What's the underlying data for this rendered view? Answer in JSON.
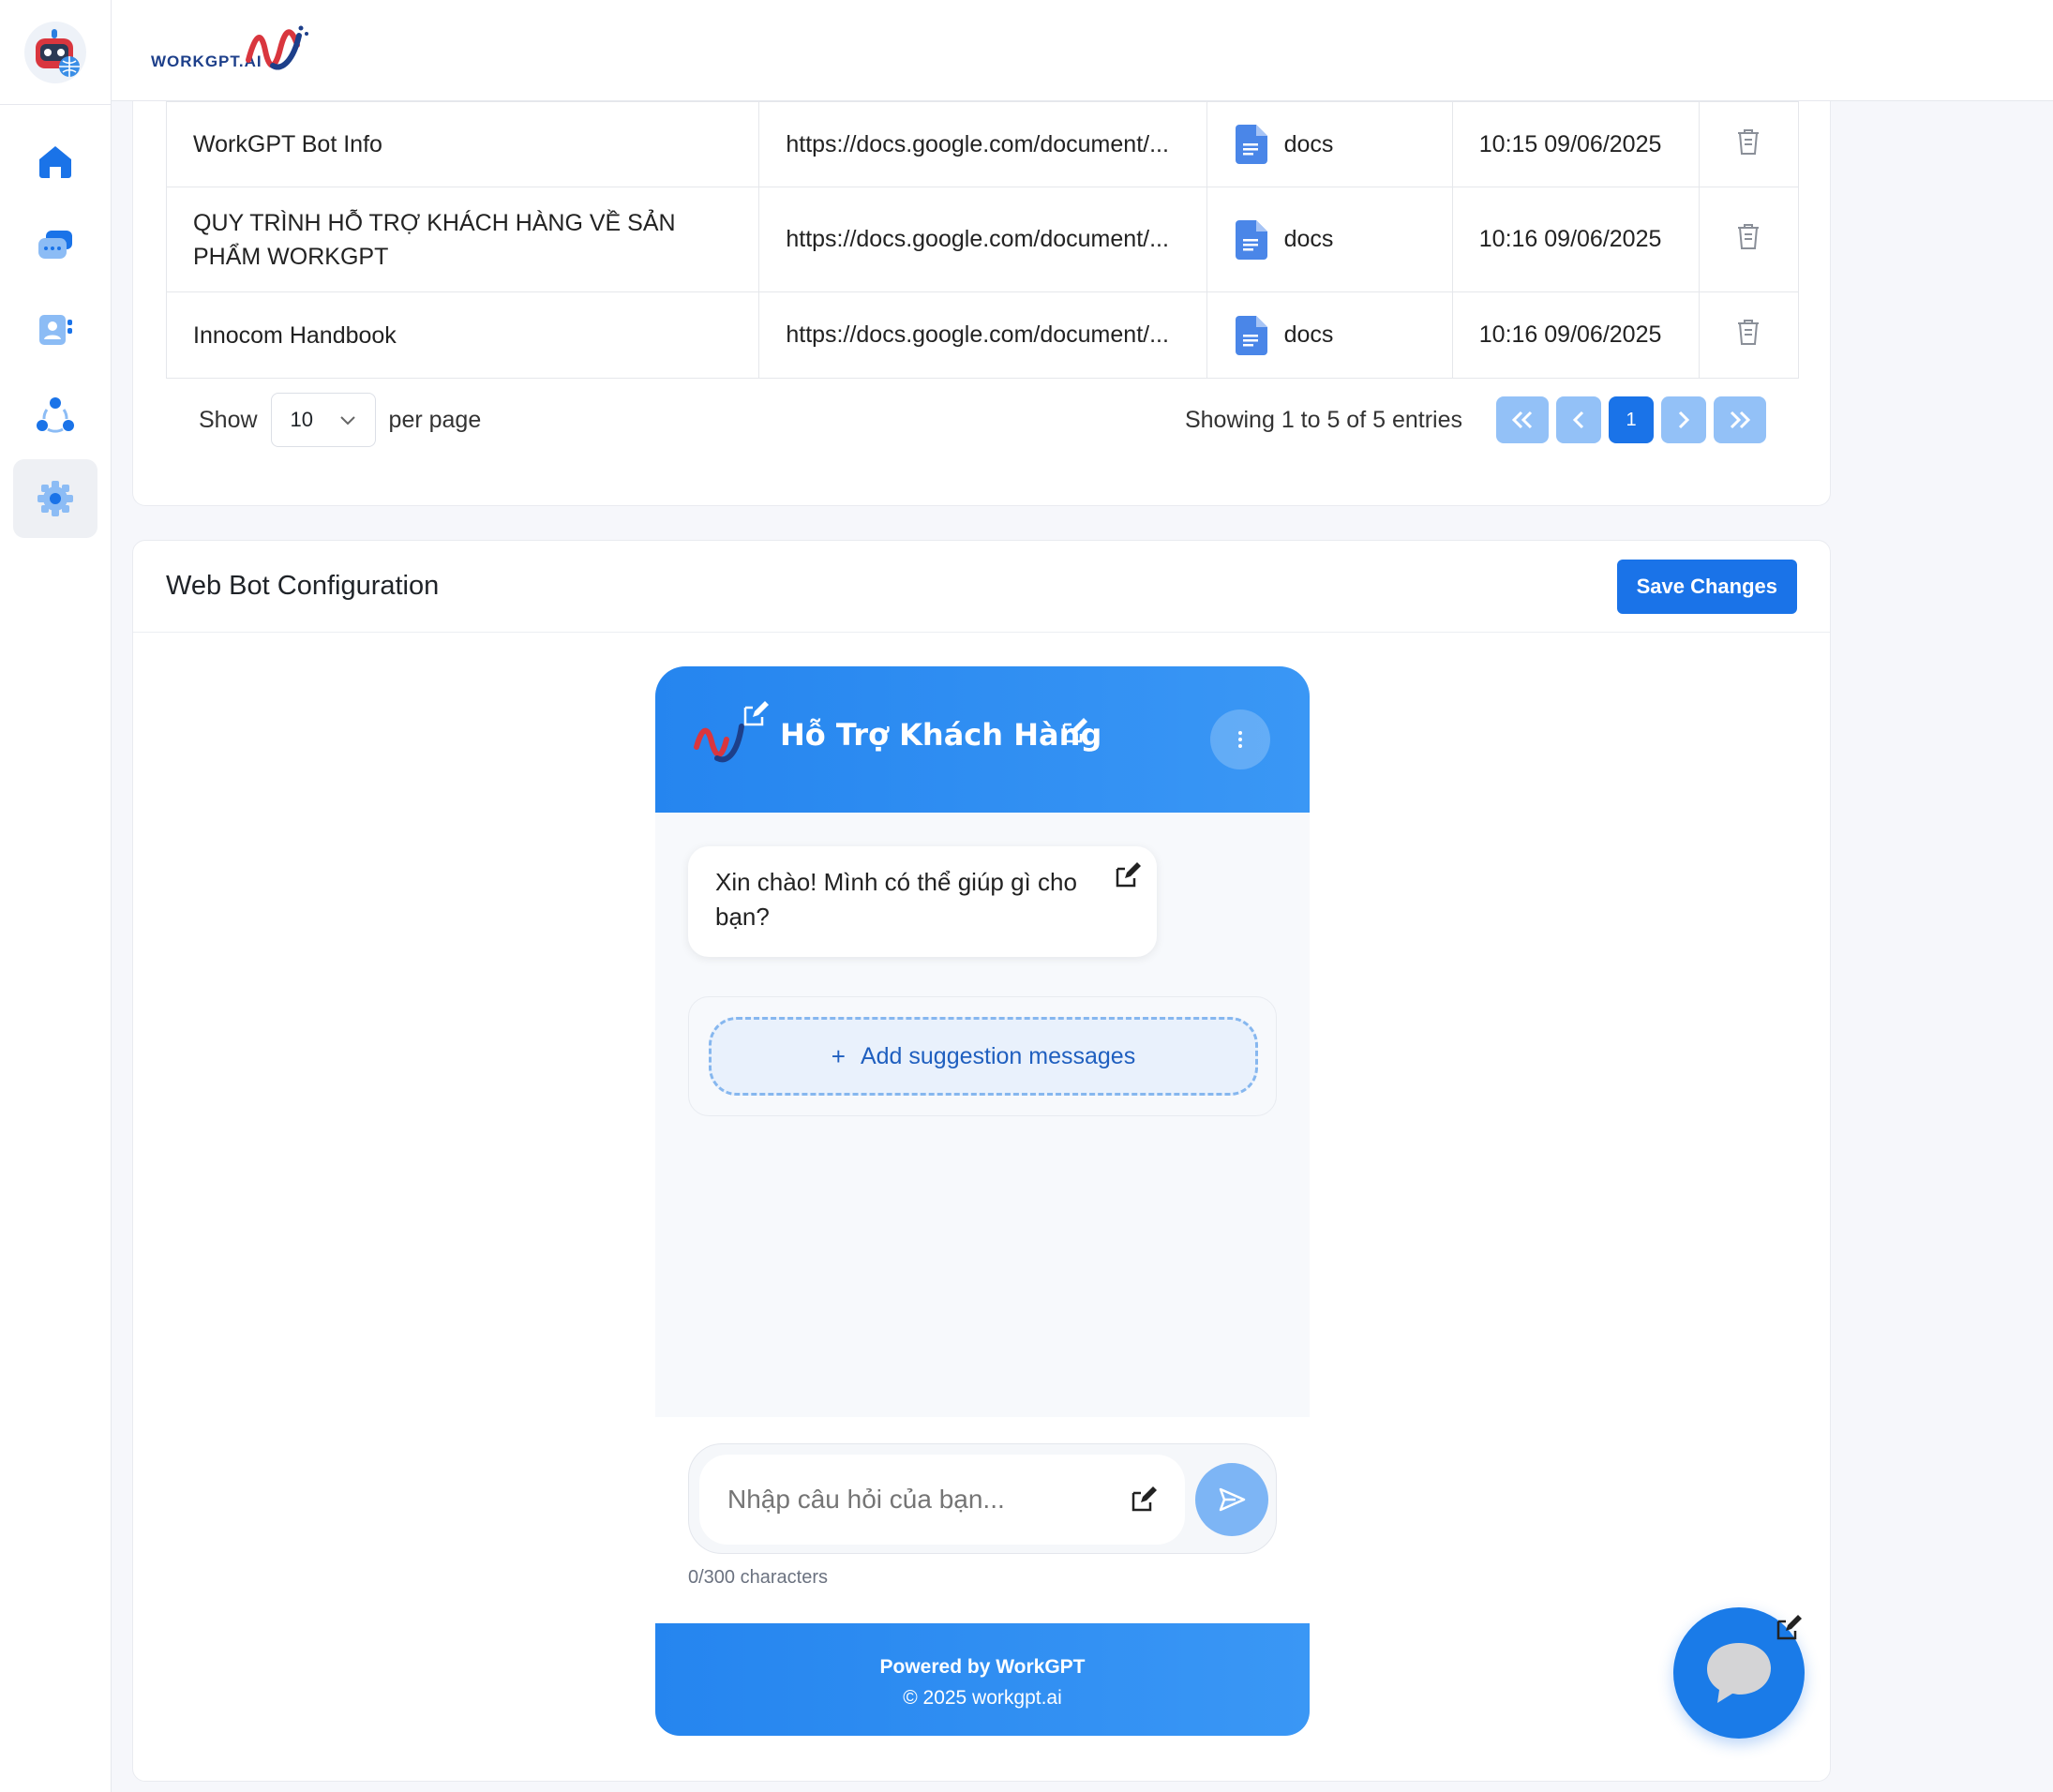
{
  "brand": {
    "logo_text": "WORKGPT.AI"
  },
  "sidebar": {
    "items": [
      {
        "name": "home",
        "icon": "home-icon"
      },
      {
        "name": "chats",
        "icon": "chat-icon"
      },
      {
        "name": "contacts",
        "icon": "contact-card-icon"
      },
      {
        "name": "integrations",
        "icon": "network-icon"
      },
      {
        "name": "settings",
        "icon": "gear-icon",
        "active": true
      }
    ]
  },
  "documents": {
    "rows": [
      {
        "name": "WorkGPT Bot Info",
        "link": "https://docs.google.com/document/...",
        "type": "docs",
        "date": "10:15 09/06/2025"
      },
      {
        "name": "QUY TRÌNH HỖ TRỢ KHÁCH HÀNG VỀ SẢN PHẨM WORKGPT",
        "link": "https://docs.google.com/document/...",
        "type": "docs",
        "date": "10:16 09/06/2025"
      },
      {
        "name": "Innocom Handbook",
        "link": "https://docs.google.com/document/...",
        "type": "docs",
        "date": "10:16 09/06/2025"
      }
    ],
    "pagination": {
      "show_label": "Show",
      "per_page_value": "10",
      "per_page_label": "per page",
      "entries_text": "Showing 1 to 5 of 5 entries",
      "current_page": "1"
    }
  },
  "config": {
    "title": "Web Bot Configuration",
    "save_label": "Save Changes",
    "widget": {
      "title": "Hỗ Trợ Khách Hàng",
      "greeting": "Xin chào! Mình có thể giúp gì cho bạn?",
      "add_suggestion_label": "Add suggestion messages",
      "input_placeholder": "Nhập câu hỏi của bạn...",
      "char_count": "0/300 characters",
      "footer_powered": "Powered by WorkGPT",
      "footer_copyright": "© 2025 workgpt.ai"
    }
  },
  "colors": {
    "primary": "#1a73e8",
    "widget_header": "#2e8ff0",
    "link": "#2d6fd3"
  }
}
